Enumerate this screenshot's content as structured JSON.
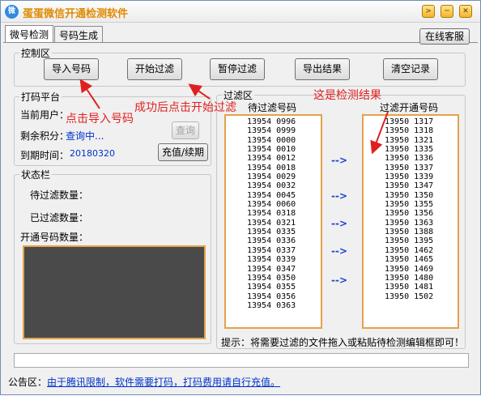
{
  "window": {
    "title": "蛋蛋微信开通检测软件",
    "icon": "wechat-icon"
  },
  "window_controls": {
    "menu": "menu-icon",
    "minimize": "minimize-icon",
    "close": "close-icon"
  },
  "tabs": [
    {
      "label": "微号检测"
    },
    {
      "label": "号码生成"
    }
  ],
  "support_button": "在线客服",
  "control_area": {
    "title": "控制区",
    "buttons": {
      "import": "导入号码",
      "start": "开始过滤",
      "pause": "暂停过滤",
      "export": "导出结果",
      "clear": "清空记录"
    }
  },
  "platform": {
    "title": "打码平台",
    "user_label": "当前用户：",
    "points_label": "剩余积分：",
    "points_value": "查询中...",
    "expiry_label": "到期时间：",
    "expiry_value": "20180320",
    "query_button": "查询",
    "recharge_button": "充值/续期"
  },
  "status": {
    "title": "状态栏",
    "pending_label": "待过滤数量：",
    "filtered_label": "已过滤数量：",
    "opened_label": "开通号码数量："
  },
  "filter_area": {
    "title": "过滤区",
    "left_header": "待过滤号码",
    "right_header": "过滤开通号码",
    "left_list": [
      "13954 0996",
      "13954 0999",
      "13954 0000",
      "13954 0010",
      "13954 0012",
      "13954 0018",
      "13954 0029",
      "13954 0032",
      "13954 0045",
      "13954 0060",
      "13954 0318",
      "13954 0321",
      "13954 0335",
      "13954 0336",
      "13954 0337",
      "13954 0339",
      "13954 0347",
      "13954 0350",
      "13954 0355",
      "13954 0356",
      "13954 0363"
    ],
    "right_list": [
      "13950 1317",
      "13950 1318",
      "13950 1321",
      "13950 1335",
      "13950 1336",
      "13950 1337",
      "13950 1339",
      "13950 1347",
      "13950 1350",
      "13950 1355",
      "13950 1356",
      "13950 1363",
      "13950 1388",
      "13950 1395",
      "13950 1462",
      "13950 1465",
      "13950 1469",
      "13950 1480",
      "13950 1481",
      "13950 1502"
    ],
    "arrows": [
      "-->",
      "-->",
      "-->",
      "-->",
      "-->"
    ],
    "hint": "提示：将需要过滤的文件拖入或粘贴待检测编辑框即可！"
  },
  "annotations": {
    "import_hint": "点击导入号码",
    "start_hint": "成功后点击开始过滤",
    "result_hint": "这是检测结果"
  },
  "notice": {
    "label": "公告区：",
    "text": "由于腾讯限制，软件需要打码，打码费用请自行充值。"
  },
  "colors": {
    "title": "#e08a00",
    "list_border": "#e4a24a",
    "annotation": "#e02020",
    "link": "#0033cc",
    "log_bg": "#4a4a4a"
  }
}
